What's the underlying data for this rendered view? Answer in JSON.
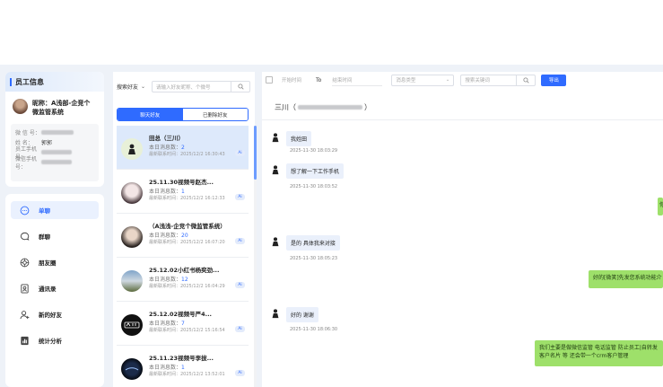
{
  "employee": {
    "section_title": "员工信息",
    "nickname_line": "昵称：A浅部-企竞个微监管系统",
    "fields": [
      {
        "label": "微 信 号：",
        "value": ""
      },
      {
        "label": "姓    名：",
        "value": "郭郭"
      },
      {
        "label": "员工手机号：",
        "value": ""
      },
      {
        "label": "微信手机号：",
        "value": ""
      }
    ]
  },
  "menu": [
    {
      "label": "单聊",
      "icon": "chat-bubble-icon",
      "active": true
    },
    {
      "label": "群聊",
      "icon": "group-chat-icon",
      "active": false
    },
    {
      "label": "朋友圈",
      "icon": "moments-icon",
      "active": false
    },
    {
      "label": "通讯录",
      "icon": "contacts-icon",
      "active": false
    },
    {
      "label": "新的好友",
      "icon": "new-friend-icon",
      "active": false
    },
    {
      "label": "统计分析",
      "icon": "statistics-icon",
      "active": false
    }
  ],
  "friends_panel": {
    "search_select": "搜索好友",
    "search_placeholder": "请输入好友昵称、个微号",
    "tabs": [
      "聊天好友",
      "已删除好友"
    ],
    "friends": [
      {
        "name": "田总（三川）",
        "count_label": "本日消息数：",
        "count": "2",
        "time": "最新联系时间：2025/12/2 16:30:43",
        "badge": "Ai",
        "active": true
      },
      {
        "name": "25.11.30视频号赵杰...",
        "count_label": "本日消息数：",
        "count": "1",
        "time": "最新联系时间：2025/12/2 16:12:33",
        "badge": "Ai",
        "active": false
      },
      {
        "name": "（A浅浅-企竞个微监管系统）",
        "count_label": "本日消息数：",
        "count": "20",
        "time": "最新联系时间：2025/12/2 16:07:20",
        "badge": "Ai",
        "active": false
      },
      {
        "name": "25.12.02小红书杨奕劲...",
        "count_label": "本日消息数：",
        "count": "12",
        "time": "最新联系时间：2025/12/2 16:04:29",
        "badge": "Ai",
        "active": false
      },
      {
        "name": "25.12.02视频号严4...",
        "count_label": "本日消息数：",
        "count": "7",
        "time": "最新联系时间：2025/12/2 15:16:54",
        "badge": "Ai",
        "active": false
      },
      {
        "name": "25.11.23视频号李拔...",
        "count_label": "本日消息数：",
        "count": "1",
        "time": "最新联系时间：2025/12/2 13:52:01",
        "badge": "Ai",
        "active": false
      }
    ]
  },
  "chat": {
    "filters": {
      "start_placeholder": "开始时间",
      "to_label": "To",
      "end_placeholder": "结束时间",
      "type_placeholder": "消息类型",
      "keyword_placeholder": "搜索关键词",
      "export_label": "导出"
    },
    "title_prefix": "三川（",
    "title_suffix": "）",
    "messages": [
      {
        "dir": "in",
        "text": "我姓田",
        "time": "2025-11-30 18:03:29"
      },
      {
        "dir": "in",
        "text": "想了解一下工作手机",
        "time": "2025-11-30 18:03:52"
      },
      {
        "dir": "out",
        "text": "你"
      },
      {
        "dir": "in",
        "text": "是的 具体我来对接",
        "time": "2025-11-30 18:05:23"
      },
      {
        "dir": "out",
        "text": "好的[微笑]先发您系统功能介"
      },
      {
        "dir": "in",
        "text": "好的 谢谢",
        "time": "2025-11-30 18:06:30"
      },
      {
        "dir": "out",
        "text": "我们主要是做微信监管 电话监管 防止员工|自转发客户名片 等 还会带一个crm客户管理"
      }
    ]
  }
}
